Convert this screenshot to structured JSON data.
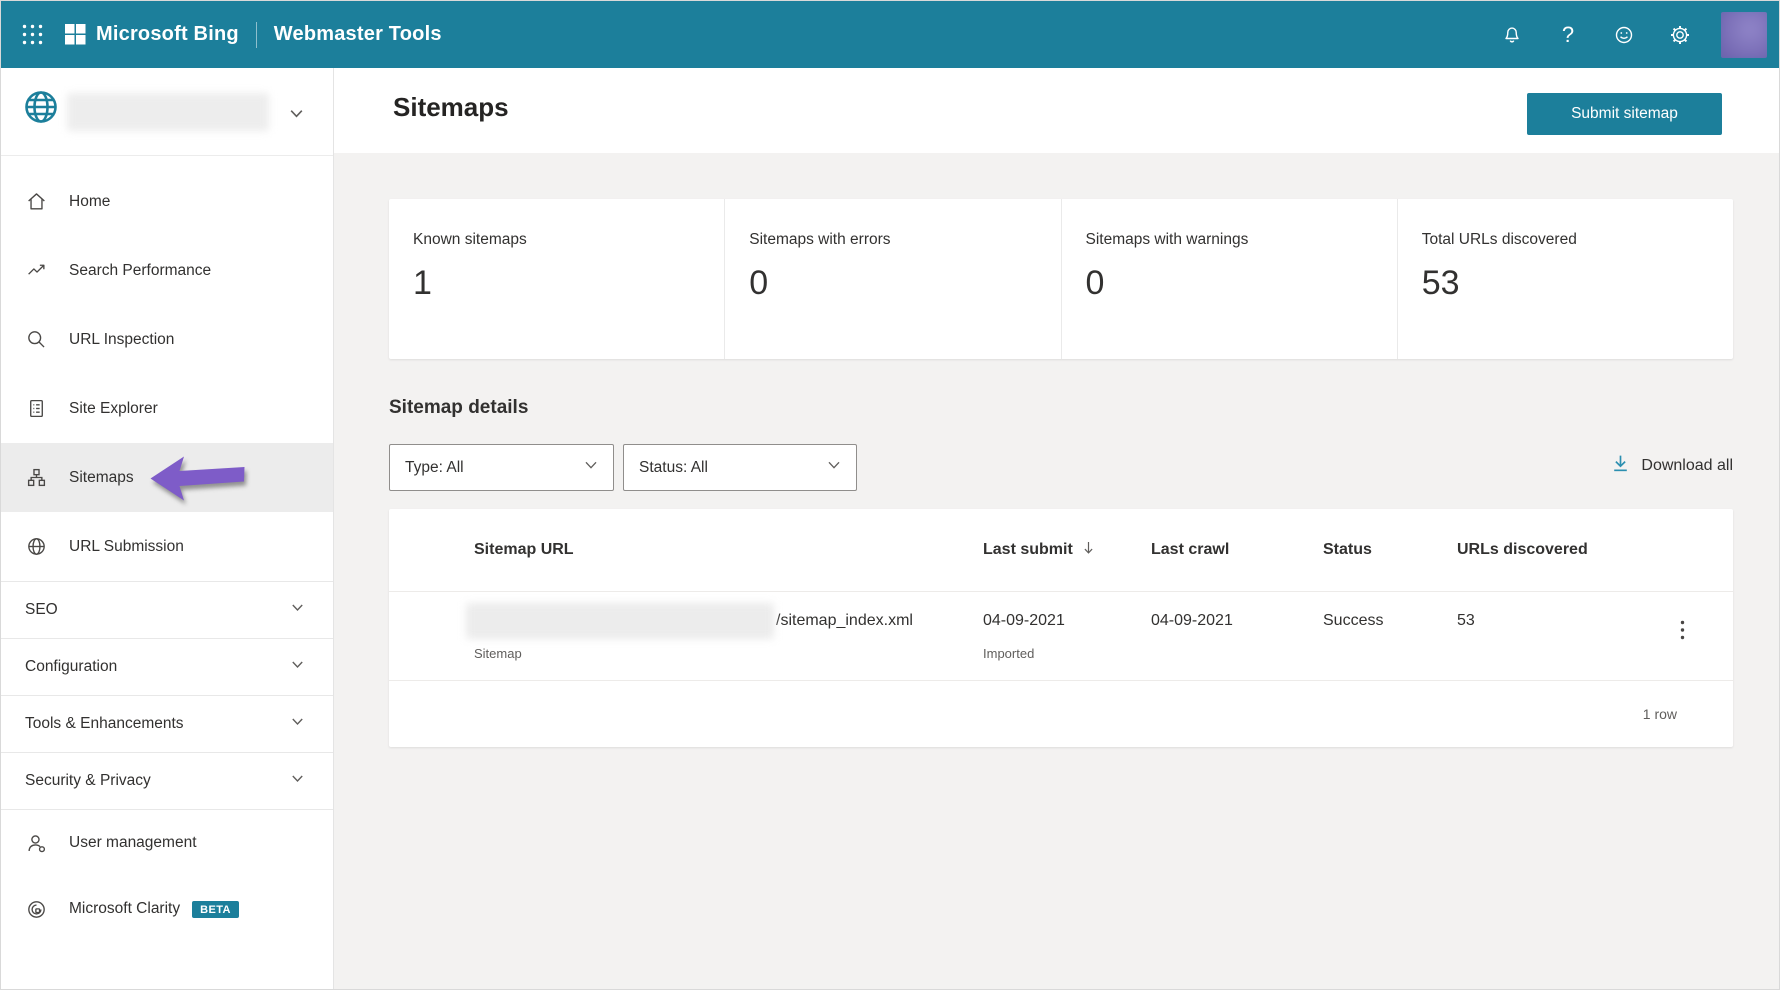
{
  "topbar": {
    "brand": "Microsoft Bing",
    "product": "Webmaster Tools",
    "help_icon": "?",
    "icons": [
      "waffle-icon",
      "microsoft-logo",
      "bell-icon",
      "question-mark-icon",
      "smiley-icon",
      "gear-icon",
      "avatar"
    ]
  },
  "sidebar": {
    "site_selector": {
      "icon": "globe-icon",
      "site_name_redacted": true
    },
    "items": [
      {
        "label": "Home",
        "icon": "home-icon"
      },
      {
        "label": "Search Performance",
        "icon": "trending-up-icon"
      },
      {
        "label": "URL Inspection",
        "icon": "magnifier-icon"
      },
      {
        "label": "Site Explorer",
        "icon": "document-list-icon"
      },
      {
        "label": "Sitemaps",
        "icon": "sitemap-icon",
        "active": true
      },
      {
        "label": "URL Submission",
        "icon": "globe-icon"
      },
      {
        "label": "SEO",
        "expandable": true
      },
      {
        "label": "Configuration",
        "expandable": true
      },
      {
        "label": "Tools & Enhancements",
        "expandable": true
      },
      {
        "label": "Security & Privacy",
        "expandable": true
      },
      {
        "label": "User management",
        "icon": "person-icon"
      },
      {
        "label": "Microsoft Clarity",
        "icon": "clarity-icon",
        "badge": "BETA"
      }
    ]
  },
  "page": {
    "title": "Sitemaps",
    "submit_button": "Submit sitemap"
  },
  "stats": [
    {
      "label": "Known sitemaps",
      "value": "1"
    },
    {
      "label": "Sitemaps with errors",
      "value": "0"
    },
    {
      "label": "Sitemaps with warnings",
      "value": "0"
    },
    {
      "label": "Total URLs discovered",
      "value": "53"
    }
  ],
  "details": {
    "heading": "Sitemap details",
    "type_filter": "Type: All",
    "status_filter": "Status: All",
    "download_all": "Download all"
  },
  "table": {
    "columns": [
      "Sitemap URL",
      "Last submit",
      "Last crawl",
      "Status",
      "URLs discovered"
    ],
    "sorted_column": "Last submit",
    "row": {
      "url_redacted": true,
      "url_suffix": "/sitemap_index.xml",
      "url_type": "Sitemap",
      "last_submit": "04-09-2021",
      "last_submit_note": "Imported",
      "last_crawl": "04-09-2021",
      "status": "Success",
      "urls_discovered": "53"
    },
    "footer": "1 row"
  },
  "colors": {
    "accent_teal": "#1c7f9b",
    "content_background": "#f3f2f1",
    "annotation_arrow_purple": "#7e5cc8",
    "active_nav_background": "#ececec",
    "secondary_text": "#605e5c"
  }
}
